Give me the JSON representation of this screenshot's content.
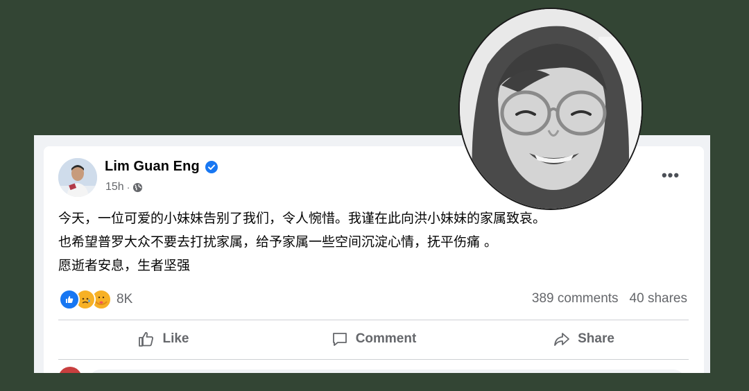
{
  "post": {
    "author": "Lim Guan Eng",
    "time": "15h",
    "meta_separator": "·",
    "body_lines": [
      "今天，一位可爱的小妹妹告别了我们，令人惋惜。我谨在此向洪小妹妹的家属致哀。",
      "也希望普罗大众不要去打扰家属，给予家属一些空间沉淀心情，抚平伤痛 。",
      "愿逝者安息，生者坚强"
    ],
    "reaction_count": "8K",
    "comments_count": "389 comments",
    "shares_count": "40 shares",
    "more_label": "•••",
    "reaction_types": [
      "like-icon",
      "sad-icon",
      "care-icon"
    ]
  },
  "actions": {
    "like_label": "Like",
    "comment_label": "Comment",
    "share_label": "Share"
  },
  "colors": {
    "background": "#334534",
    "facebook_blue": "#1877f2",
    "secondary_text": "#65676b"
  }
}
